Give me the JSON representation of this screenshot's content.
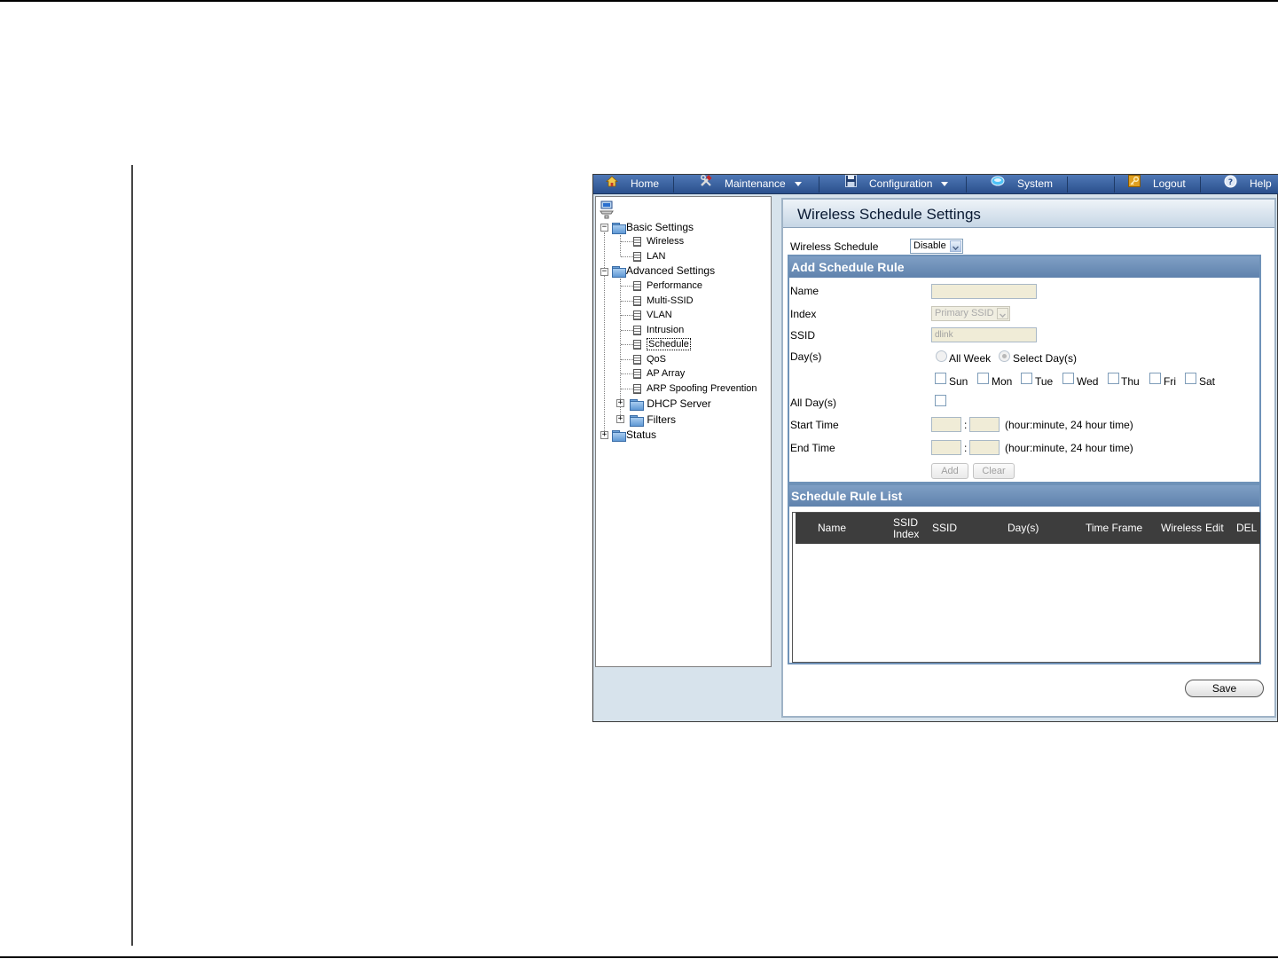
{
  "menu": {
    "home": "Home",
    "maintenance": "Maintenance",
    "configuration": "Configuration",
    "system": "System",
    "logout": "Logout",
    "help": "Help"
  },
  "tree": {
    "basic_settings": "Basic Settings",
    "basic_items": [
      "Wireless",
      "LAN"
    ],
    "advanced_settings": "Advanced Settings",
    "advanced_items": [
      "Performance",
      "Multi-SSID",
      "VLAN",
      "Intrusion",
      "Schedule",
      "QoS",
      "AP Array",
      "ARP Spoofing Prevention"
    ],
    "dhcp_server": "DHCP Server",
    "filters": "Filters",
    "status": "Status",
    "selected": "Schedule"
  },
  "page": {
    "title": "Wireless Schedule Settings",
    "wireless_schedule_label": "Wireless Schedule",
    "wireless_schedule_value": "Disable"
  },
  "add_rule": {
    "title": "Add Schedule Rule",
    "name_label": "Name",
    "name_value": "",
    "index_label": "Index",
    "index_value": "Primary SSID",
    "ssid_label": "SSID",
    "ssid_value": "dlink",
    "days_label": "Day(s)",
    "all_week": "All Week",
    "select_days": "Select Day(s)",
    "day_names": [
      "Sun",
      "Mon",
      "Tue",
      "Wed",
      "Thu",
      "Fri",
      "Sat"
    ],
    "all_days_label": "All Day(s)",
    "start_time_label": "Start Time",
    "end_time_label": "End Time",
    "time_sep": ":",
    "time_hint": "(hour:minute, 24 hour time)",
    "add_button": "Add",
    "clear_button": "Clear"
  },
  "rule_list": {
    "title": "Schedule Rule List",
    "columns": [
      "Name",
      "SSID Index",
      "SSID",
      "Day(s)",
      "Time Frame",
      "Wireless",
      "Edit",
      "DEL"
    ],
    "rows": []
  },
  "save_button": "Save",
  "colors": {
    "menubar": "#2a4f8c",
    "section_header": "#6f92b8",
    "list_header": "#3d3d3d",
    "field_bg": "#f0ecd7"
  }
}
